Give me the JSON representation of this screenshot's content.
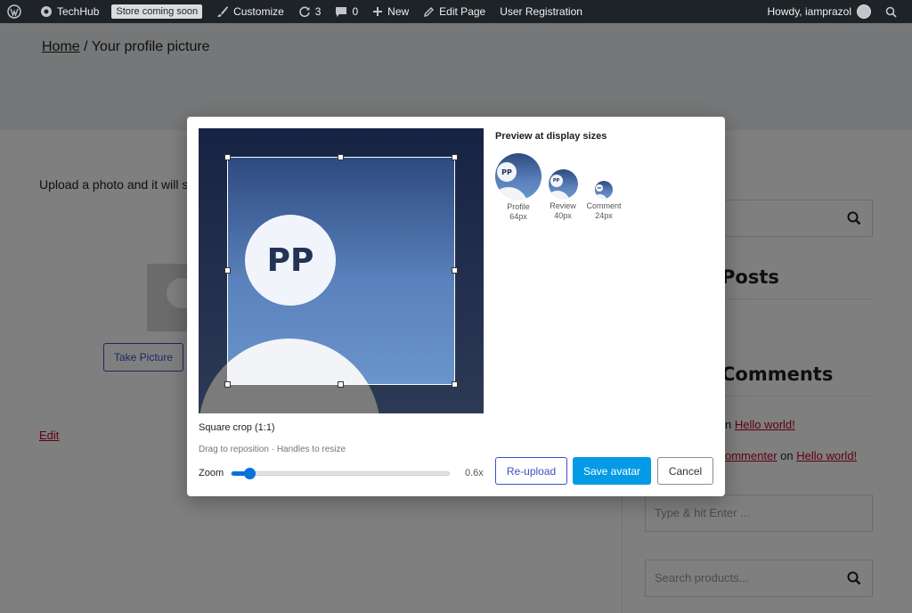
{
  "admin_bar": {
    "site_name": "TechHub",
    "store_badge": "Store coming soon",
    "customize": "Customize",
    "updates_count": "3",
    "comments_count": "0",
    "new": "New",
    "edit_page": "Edit Page",
    "user_registration": "User Registration",
    "howdy": "Howdy, iamprazol"
  },
  "page": {
    "breadcrumb_home": "Home",
    "breadcrumb_separator": "/",
    "breadcrumb_current": "Your profile picture",
    "intro_text": "Upload a photo and it will sh",
    "take_picture": "Take Picture",
    "edit_link": "Edit"
  },
  "sidebar": {
    "recent_posts_heading": "Posts",
    "recent_comments_heading": "Comments",
    "comment_1_prefix": "n",
    "comment_1_link": "Hello world!",
    "comment_2_author": "ommenter",
    "comment_2_on": "on",
    "comment_2_link": "Hello world!",
    "type_input_placeholder": "Type & hit Enter ...",
    "products_search_placeholder": "Search products..."
  },
  "modal": {
    "avatar_initials": "PP",
    "crop_title": "Square crop (1:1)",
    "crop_help": "Drag to reposition · Handles to resize",
    "zoom_label": "Zoom",
    "zoom_value": "0.6x",
    "zoom_fraction": 0.06,
    "preview_title": "Preview at display sizes",
    "previews": [
      {
        "name": "Profile",
        "size": "64px"
      },
      {
        "name": "Review",
        "size": "40px"
      },
      {
        "name": "Comment",
        "size": "24px"
      }
    ],
    "reupload": "Re-upload",
    "save": "Save avatar",
    "cancel": "Cancel"
  },
  "colors": {
    "admin_bar_bg": "#1d2327",
    "primary_button": "#039be5",
    "outline_button": "#3c50c8",
    "link_red": "#c00024",
    "slider": "#0a72dd"
  },
  "icons": [
    "wordpress-icon",
    "brush-icon",
    "refresh-icon",
    "comment-icon",
    "plus-icon",
    "pencil-icon",
    "search-icon"
  ]
}
